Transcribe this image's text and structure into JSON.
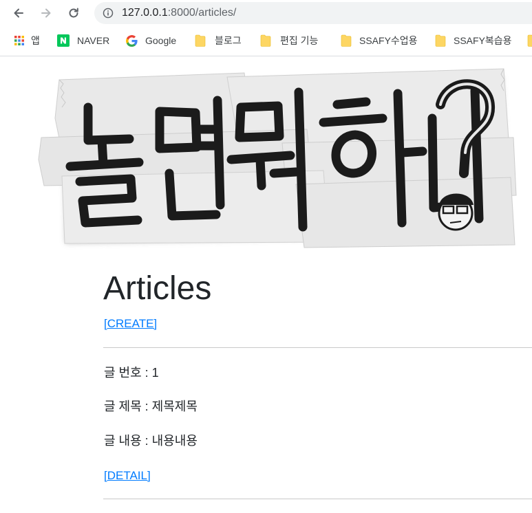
{
  "browser": {
    "url_host": "127.0.0.1",
    "url_rest": ":8000/articles/",
    "bookmarks": [
      {
        "label": "앱",
        "icon": "apps-grid-icon"
      },
      {
        "label": "NAVER",
        "icon": "naver-icon"
      },
      {
        "label": "Google",
        "icon": "google-icon"
      },
      {
        "label": "블로그",
        "icon": "folder-icon"
      },
      {
        "label": "편집 기능",
        "icon": "folder-icon"
      },
      {
        "label": "SSAFY수업용",
        "icon": "folder-icon"
      },
      {
        "label": "SSAFY복습용",
        "icon": "folder-icon"
      }
    ]
  },
  "banner": {
    "logo_text": "놀면뭐하니?"
  },
  "page": {
    "title": "Articles",
    "create_link": "[CREATE]"
  },
  "articles": [
    {
      "number_line": "글 번호 : 1",
      "title_line": "글 제목 : 제목제목",
      "content_line": "글 내용 : 내용내용",
      "detail_link": "[DETAIL]"
    }
  ],
  "colors": {
    "link": "#007bff",
    "naver_green": "#03c75a",
    "folder_yellow": "#fdd663"
  }
}
